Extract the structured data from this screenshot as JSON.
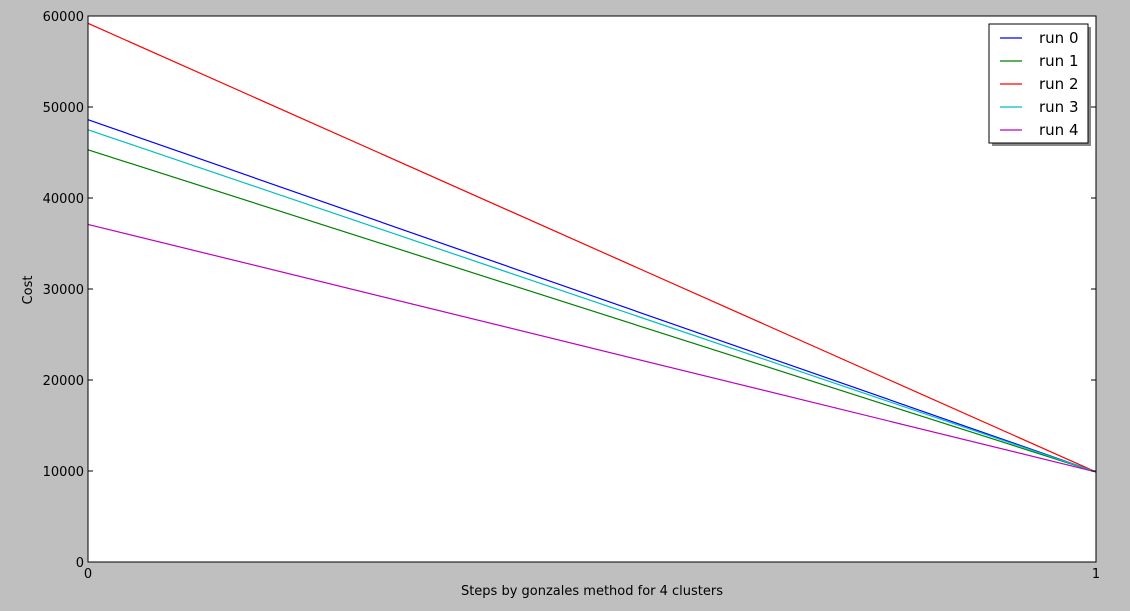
{
  "chart_data": {
    "type": "line",
    "title": "",
    "xlabel": "Steps by gonzales method for 4 clusters",
    "ylabel": "Cost",
    "x": [
      0,
      1
    ],
    "xlim": [
      0,
      1
    ],
    "ylim": [
      0,
      60000
    ],
    "xticks": [
      0,
      1
    ],
    "xtick_labels": [
      "0",
      "1"
    ],
    "yticks": [
      0,
      10000,
      20000,
      30000,
      40000,
      50000,
      60000
    ],
    "ytick_labels": [
      "0",
      "10000",
      "20000",
      "30000",
      "40000",
      "50000",
      "60000"
    ],
    "grid": false,
    "legend_position": "top-right",
    "series": [
      {
        "name": "run 0",
        "color": "#0000ff",
        "values": [
          48600,
          9900
        ]
      },
      {
        "name": "run 1",
        "color": "#008000",
        "values": [
          45300,
          9900
        ]
      },
      {
        "name": "run 2",
        "color": "#ff0000",
        "values": [
          59200,
          9900
        ]
      },
      {
        "name": "run 3",
        "color": "#00bfbf",
        "values": [
          47500,
          9900
        ]
      },
      {
        "name": "run 4",
        "color": "#bf00bf",
        "values": [
          37100,
          9900
        ]
      }
    ]
  }
}
